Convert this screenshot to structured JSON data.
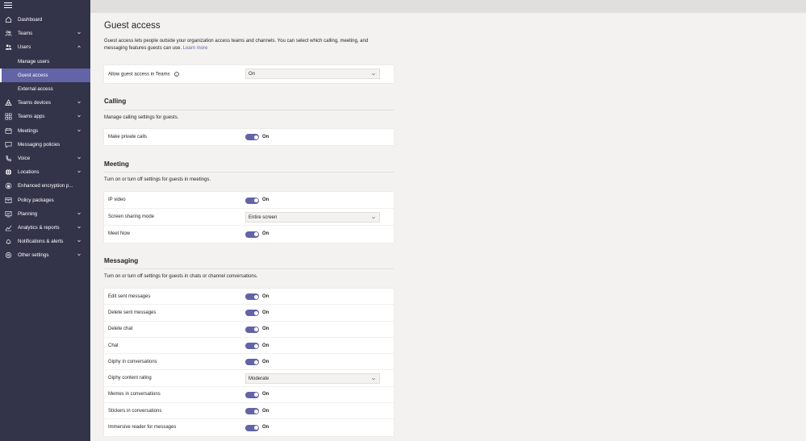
{
  "sidebar": {
    "items": [
      {
        "label": "Dashboard",
        "icon": "home-icon",
        "chevron": false
      },
      {
        "label": "Teams",
        "icon": "teams-icon",
        "chevron": true
      },
      {
        "label": "Users",
        "icon": "users-icon",
        "chevron": true
      },
      {
        "label": "Manage users",
        "icon": "",
        "chevron": false,
        "sub": true
      },
      {
        "label": "Guest access",
        "icon": "",
        "chevron": false,
        "sub": true,
        "selected": true
      },
      {
        "label": "External access",
        "icon": "",
        "chevron": false,
        "sub": true
      },
      {
        "label": "Teams devices",
        "icon": "devices-icon",
        "chevron": true
      },
      {
        "label": "Teams apps",
        "icon": "apps-icon",
        "chevron": true
      },
      {
        "label": "Meetings",
        "icon": "meetings-icon",
        "chevron": true
      },
      {
        "label": "Messaging policies",
        "icon": "messaging-icon",
        "chevron": false
      },
      {
        "label": "Voice",
        "icon": "voice-icon",
        "chevron": true
      },
      {
        "label": "Locations",
        "icon": "globe-icon",
        "chevron": true
      },
      {
        "label": "Enhanced encryption p...",
        "icon": "encryption-icon",
        "chevron": false
      },
      {
        "label": "Policy packages",
        "icon": "packages-icon",
        "chevron": false
      },
      {
        "label": "Planning",
        "icon": "planning-icon",
        "chevron": true
      },
      {
        "label": "Analytics & reports",
        "icon": "analytics-icon",
        "chevron": true
      },
      {
        "label": "Notifications & alerts",
        "icon": "bell-icon",
        "chevron": true
      },
      {
        "label": "Other settings",
        "icon": "gear-icon",
        "chevron": true
      }
    ]
  },
  "page": {
    "title": "Guest access",
    "description": "Guest access lets people outside your organization access teams and channels. You can select which calling, meeting, and messaging features guests can use.",
    "learn_more": "Learn more"
  },
  "allow": {
    "label": "Allow guest access in Teams",
    "value": "On"
  },
  "calling": {
    "title": "Calling",
    "description": "Manage calling settings for guests.",
    "rows": [
      {
        "label": "Make private calls",
        "type": "toggle",
        "value": "On"
      }
    ]
  },
  "meeting": {
    "title": "Meeting",
    "description": "Turn on or turn off settings for guests in meetings.",
    "rows": [
      {
        "label": "IP video",
        "type": "toggle",
        "value": "On"
      },
      {
        "label": "Screen sharing mode",
        "type": "select",
        "value": "Entire screen"
      },
      {
        "label": "Meet Now",
        "type": "toggle",
        "value": "On"
      }
    ]
  },
  "messaging": {
    "title": "Messaging",
    "description": "Turn on or turn off settings for guests in chats or channel conversations.",
    "rows": [
      {
        "label": "Edit sent messages",
        "type": "toggle",
        "value": "On"
      },
      {
        "label": "Delete sent messages",
        "type": "toggle",
        "value": "On"
      },
      {
        "label": "Delete chat",
        "type": "toggle",
        "value": "On"
      },
      {
        "label": "Chat",
        "type": "toggle",
        "value": "On"
      },
      {
        "label": "Giphy in conversations",
        "type": "toggle",
        "value": "On"
      },
      {
        "label": "Giphy content rating",
        "type": "select",
        "value": "Moderate"
      },
      {
        "label": "Memes in conversations",
        "type": "toggle",
        "value": "On"
      },
      {
        "label": "Stickers in conversations",
        "type": "toggle",
        "value": "On"
      },
      {
        "label": "Immersive reader for messages",
        "type": "toggle",
        "value": "On"
      }
    ]
  },
  "colors": {
    "sidebar_bg": "#33344a",
    "accent": "#6264a7",
    "page_bg": "#f3f2f1"
  }
}
